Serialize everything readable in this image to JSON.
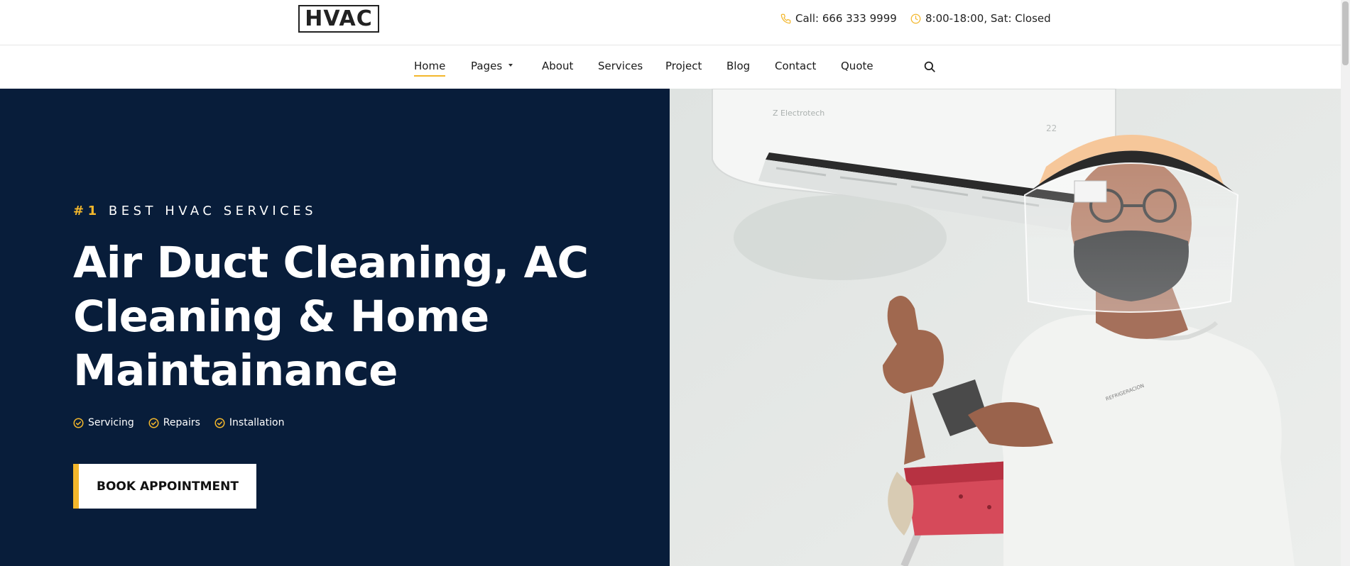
{
  "brand": {
    "logo_text": "HVAC"
  },
  "topbar": {
    "phone": "Call: 666 333 9999",
    "hours": "8:00-18:00, Sat: Closed"
  },
  "nav": {
    "items": [
      {
        "label": "Home",
        "active": true
      },
      {
        "label": "Pages",
        "dropdown": true
      },
      {
        "label": "About"
      },
      {
        "label": "Services"
      },
      {
        "label": "Project"
      },
      {
        "label": "Blog"
      },
      {
        "label": "Contact"
      },
      {
        "label": "Quote"
      }
    ]
  },
  "hero": {
    "eyebrow_hash": "#1",
    "eyebrow_text": "BEST HVAC SERVICES",
    "headline_line1": "Air Duct Cleaning, AC",
    "headline_line2": "Cleaning & Home",
    "headline_line3": "Maintainance",
    "features": [
      "Servicing",
      "Repairs",
      "Installation"
    ],
    "cta_label": "BOOK APPOINTMENT"
  },
  "colors": {
    "accent": "#f3b72c",
    "hero_bg": "#081d3a"
  },
  "icons": {
    "phone": "phone-icon",
    "clock": "clock-icon",
    "search": "search-icon",
    "check": "check-circle-icon"
  }
}
